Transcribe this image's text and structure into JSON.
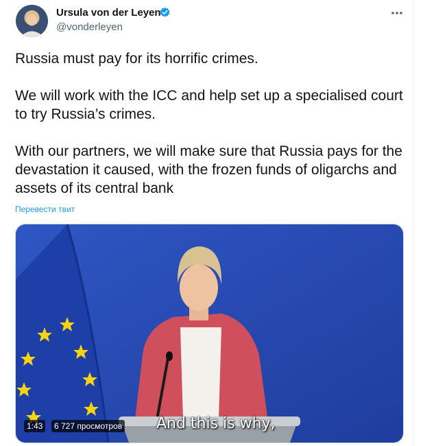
{
  "author": {
    "name": "Ursula von der Leyen",
    "handle": "@vonderleyen",
    "verified_icon": "verified-badge-icon",
    "avatar_icon": "avatar"
  },
  "tweet": {
    "paragraphs": [
      "Russia must pay for its horrific crimes.",
      "We will work with the ICC and help set up a specialised court to try Russia’s crimes.",
      "With our partners, we will make sure that Russia pays for the devastation it caused, with the frozen funds of oligarchs and assets of its central bank"
    ],
    "translate_link": "Перевести твит"
  },
  "media": {
    "duration": "1:43",
    "views": "6 727 просмотров",
    "subtitle": "And this is why,"
  },
  "colors": {
    "accent": "#1d9bf0",
    "text": "#0f1419",
    "muted": "#536471",
    "video_bg": "#2c4fb5",
    "eu_flag": "#1f3fa8",
    "eu_star": "#f8d311",
    "jacket": "#cf4f5c"
  }
}
